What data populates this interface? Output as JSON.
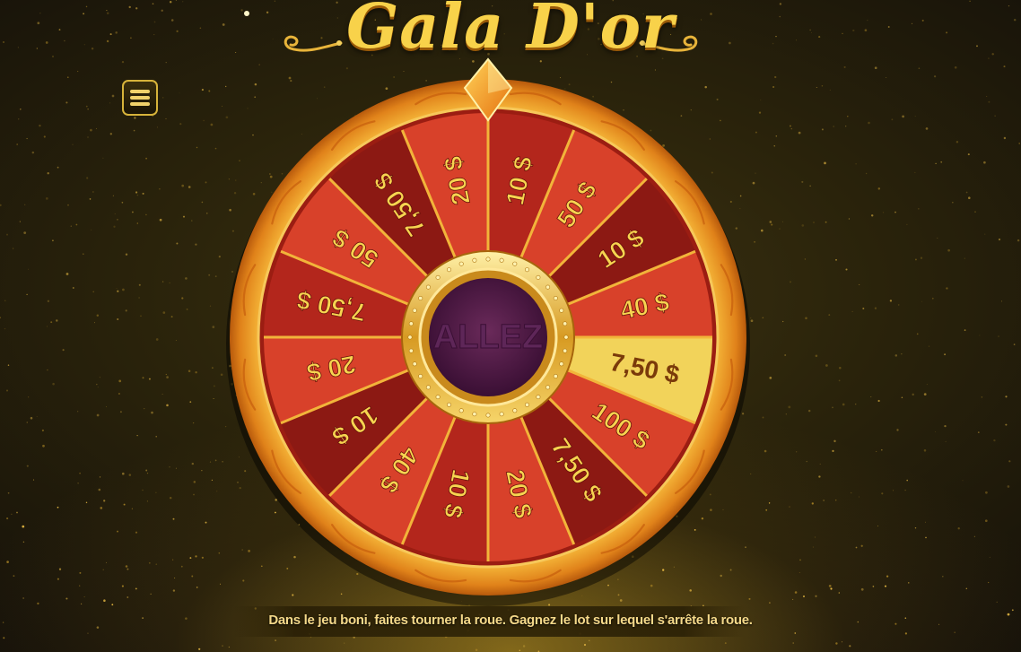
{
  "logo": {
    "title": "Gala D'or"
  },
  "menu": {
    "icon": "hamburger-icon"
  },
  "wheel": {
    "center_label": "ALLEZ",
    "highlighted_index": 4,
    "segments": [
      {
        "label": "10 $"
      },
      {
        "label": "50 $"
      },
      {
        "label": "10 $"
      },
      {
        "label": "40 $"
      },
      {
        "label": "7,50 $"
      },
      {
        "label": "100 $"
      },
      {
        "label": "7,50 $"
      },
      {
        "label": "20 $"
      },
      {
        "label": "10 $"
      },
      {
        "label": "40 $"
      },
      {
        "label": "10 $"
      },
      {
        "label": "20 $"
      },
      {
        "label": "7,50 $"
      },
      {
        "label": "50 $"
      },
      {
        "label": "7,50 $"
      },
      {
        "label": "20 $"
      }
    ],
    "colors": {
      "segment_a": "#b3261c",
      "segment_b": "#d8412a",
      "segment_dark": "#8c1913",
      "highlight": "#f2d35a",
      "divider": "#f2b43a",
      "rim": "#f09a24",
      "label": "#f7d450",
      "hub": "#4a1a4a"
    }
  },
  "footer": {
    "instructions": "Dans le jeu boni, faites tourner la roue. Gagnez le lot sur lequel s'arrête la roue."
  }
}
